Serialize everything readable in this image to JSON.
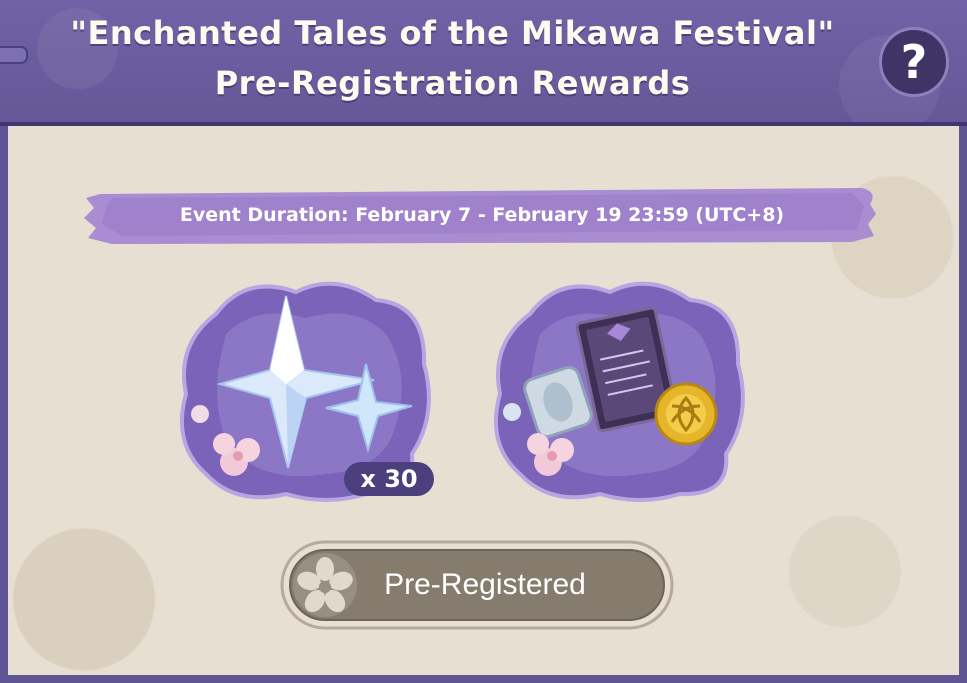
{
  "header": {
    "title_line1": "\"Enchanted Tales of the Mikawa Festival\"",
    "title_line2": "Pre-Registration Rewards",
    "help_label": "?",
    "help_icon": "question-icon"
  },
  "event": {
    "duration": "Event Duration: February 7 - February 19 23:59 (UTC+8)"
  },
  "rewards": [
    {
      "name": "primogem-reward",
      "icon": "primogem-icon",
      "quantity": "x 30"
    },
    {
      "name": "item-bundle-reward",
      "icon": "bundle-icon",
      "quantity": ""
    }
  ],
  "button": {
    "label": "Pre-Registered",
    "icon": "flower-icon"
  },
  "colors": {
    "header_bg": "#6f62a6",
    "panel_bg": "#e6dfd2",
    "banner": "#a98cd1",
    "cloud": "#7a63b8",
    "button_bg": "#857c6e"
  }
}
